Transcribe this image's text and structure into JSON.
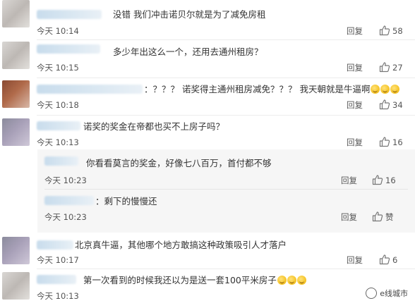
{
  "labels": {
    "reply": "回复"
  },
  "comments": [
    {
      "text": "没错 我们冲击诺贝尔就是为了减免房租",
      "time": "今天 10:14",
      "likes": "58"
    },
    {
      "text": "多少年出这么一个，还用去通州租房？",
      "time": "今天 10:15",
      "likes": "27"
    },
    {
      "text": "：？？？ 诺奖得主通州租房减免？？？ 我天朝就是牛逼啊",
      "time": "今天 10:18",
      "likes": "34"
    },
    {
      "text": "诺奖的奖金在帝都也买不上房子吗？",
      "time": "今天 10:13",
      "likes": "16"
    },
    {
      "text": "你看看莫言的奖金，好像七八百万，首付都不够",
      "time": "今天 10:23",
      "likes": "16"
    },
    {
      "text": "：剩下的慢慢还",
      "time": "今天 10:23",
      "likes": "赞"
    },
    {
      "text": "北京真牛逼，其他哪个地方敢搞这种政策吸引人才落户",
      "time": "今天 10:17",
      "likes": "6"
    },
    {
      "text": "第一次看到的时候我还以为是送一套100平米房子",
      "time": "今天 10:13",
      "likes": ""
    }
  ],
  "watermark": {
    "text": "e线城市"
  },
  "icons": {
    "like": "thumbs-up-icon",
    "emoji": "grin-sweat-emoji-icon",
    "watermark_logo": "wechat-logo-icon"
  },
  "colors": {
    "blurred_name": "#c8dcec",
    "subbox_bg": "#f6f6f6",
    "text": "#333333"
  }
}
